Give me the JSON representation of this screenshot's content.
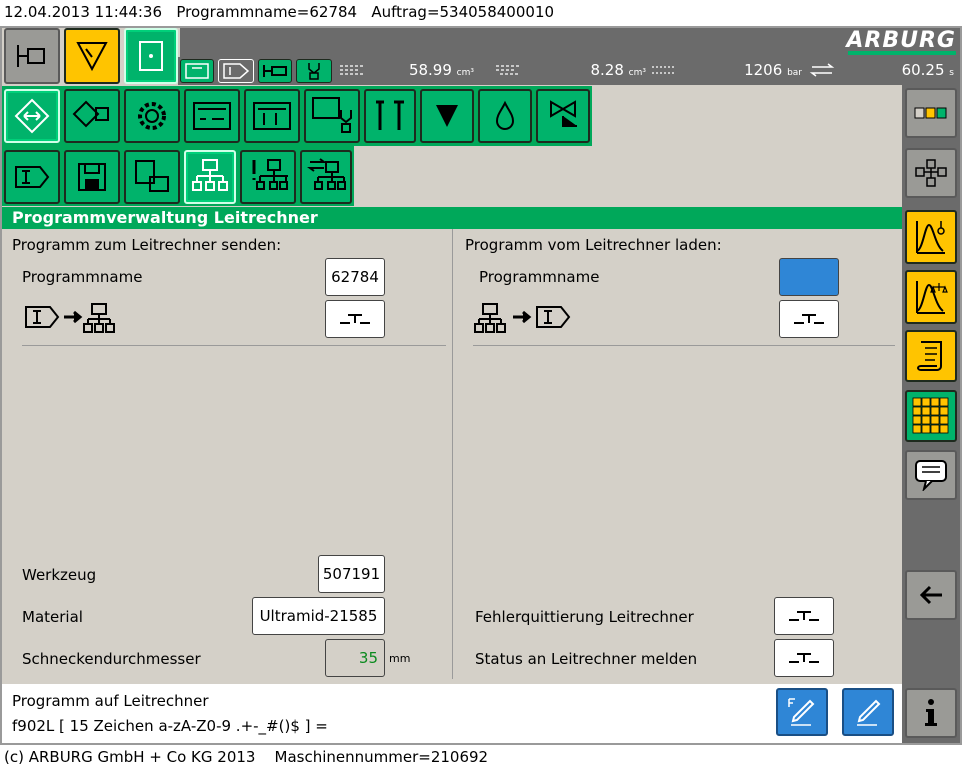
{
  "header": {
    "datetime": "12.04.2013 11:44:36",
    "program_name": "Programmname=62784",
    "order": "Auftrag=534058400010"
  },
  "brand": "ARBURG",
  "status": {
    "volume1": "58.99",
    "volume1_unit": "cm³",
    "volume2": "8.28",
    "volume2_unit": "cm³",
    "pressure": "1206",
    "pressure_unit": "bar",
    "cycle_time": "60.25",
    "cycle_time_unit": "s"
  },
  "page_title": "Programmverwaltung Leitrechner",
  "left": {
    "heading": "Programm zum Leitrechner senden:",
    "program_label": "Programmname",
    "program_value": "62784",
    "tool_label": "Werkzeug",
    "tool_value": "507191",
    "material_label": "Material",
    "material_value": "Ultramid-21585",
    "screw_label": "Schneckendurchmesser",
    "screw_value": "35",
    "screw_unit": "mm"
  },
  "right": {
    "heading": "Programm vom Leitrechner laden:",
    "program_label": "Programmname",
    "program_value": "",
    "error_ack_label": "Fehlerquittierung Leitrechner",
    "status_report_label": "Status an Leitrechner melden"
  },
  "footer": {
    "line1": "Programm auf Leitrechner",
    "line2": "f902L [ 15 Zeichen a-zA-Z0-9 .+-_#()$ ] ="
  },
  "copyright": "(c) ARBURG GmbH + Co KG 2013",
  "machine_number": "Maschinennummer=210692",
  "colors": {
    "green": "#00b36b",
    "yellow": "#ffc400",
    "blue_field": "#2f86d6",
    "side_gray": "#6b6b6b"
  }
}
